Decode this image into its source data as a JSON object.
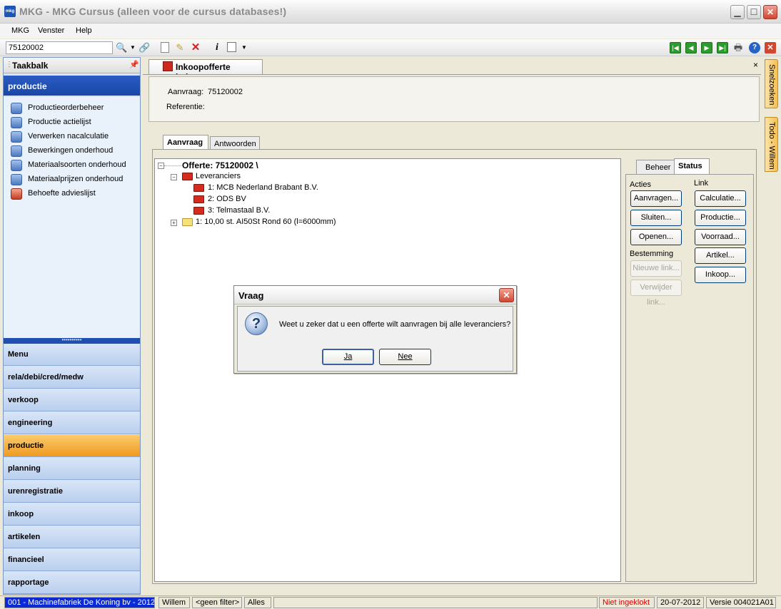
{
  "window": {
    "title": "MKG - MKG Cursus (alleen voor de cursus databases!)",
    "icon_label": "mkg"
  },
  "menu": [
    "MKG",
    "Venster",
    "Help"
  ],
  "toolbar": {
    "search_value": "75120002"
  },
  "sidebar": {
    "title": "Taakbalk",
    "section": "productie",
    "tasks": [
      "Productieorderbeheer",
      "Productie actielijst",
      "Verwerken nacalculatie",
      "Bewerkingen onderhoud",
      "Materiaalsoorten onderhoud",
      "Materiaalprijzen onderhoud",
      "Behoefte advieslijst"
    ],
    "nav": [
      "Menu",
      "rela/debi/cred/medw",
      "verkoop",
      "engineering",
      "productie",
      "planning",
      "urenregistratie",
      "inkoop",
      "artikelen",
      "financieel",
      "rapportage"
    ],
    "active_nav": "productie"
  },
  "document": {
    "tab_title": "Inkoopofferte beheer",
    "close": "×",
    "aanvraag_label": "Aanvraag:",
    "aanvraag_value": "75120002",
    "referentie_label": "Referentie:",
    "subtabs": [
      "Aanvraag",
      "Antwoorden"
    ],
    "tree": {
      "root": "Offerte: 75120002 \\",
      "leveranciers_label": "Leveranciers",
      "suppliers": [
        "1: MCB Nederland Brabant B.V.",
        "2: ODS BV",
        "3: Telmastaal B.V."
      ],
      "item": "1: 10,00 st. AI50St Rond 60 (l=6000mm)"
    },
    "right_panel": {
      "tabs": [
        "Beheer",
        "Status"
      ],
      "acties_label": "Acties",
      "link_label": "Link",
      "bestemming_label": "Bestemming",
      "acties_buttons": [
        "Aanvragen...",
        "Sluiten...",
        "Openen..."
      ],
      "link_buttons": [
        "Calculatie...",
        "Productie...",
        "Voorraad...",
        "Artikel...",
        "Inkoop..."
      ],
      "bestemming_buttons": [
        "Nieuwe link...",
        "Verwijder link..."
      ]
    }
  },
  "dialog": {
    "title": "Vraag",
    "message": "Weet u zeker dat u een offerte wilt aanvragen bij alle leveranciers?",
    "yes": "Ja",
    "no": "Nee"
  },
  "side_tabs": [
    "Snelzoeken",
    "Todo - Willem"
  ],
  "statusbar": {
    "company": "001 - Machinefabriek De Koning bv - 2012",
    "user": "Willem",
    "filter": "<geen filter>",
    "scope": "Alles",
    "clock_status": "Niet ingeklokt",
    "date": "20-07-2012",
    "version": "Versie 004021A01"
  },
  "colors": {
    "sidebar_header": "#1946a8",
    "active_nav": "#f09a1f",
    "status_company_bg": "#0a2ad8",
    "status_clock_fg": "#d40000"
  }
}
